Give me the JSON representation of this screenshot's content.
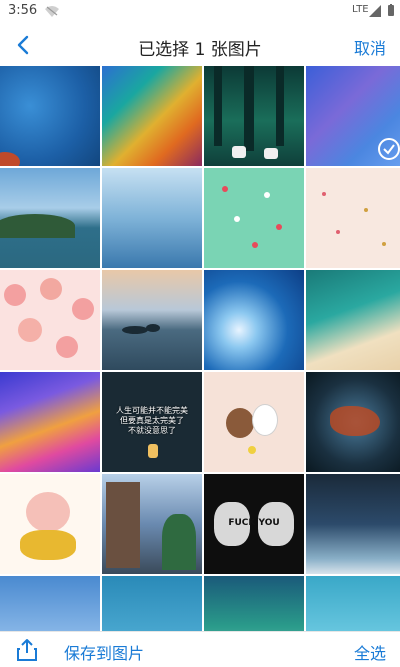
{
  "status_bar": {
    "time": "3:56",
    "network": "LTE"
  },
  "header": {
    "title": "已选择 1 张图片",
    "cancel_label": "取消"
  },
  "grid": {
    "selected_count": 1
  },
  "bottom_bar": {
    "save_label": "保存到图片",
    "select_all_label": "全选"
  },
  "tiles": {
    "quote_text": "人生可能并不能完美\n但要真是太完美了\n不就没意思了",
    "fist_text": "FUCK YOU"
  },
  "colors": {
    "accent": "#1a7bd6"
  }
}
